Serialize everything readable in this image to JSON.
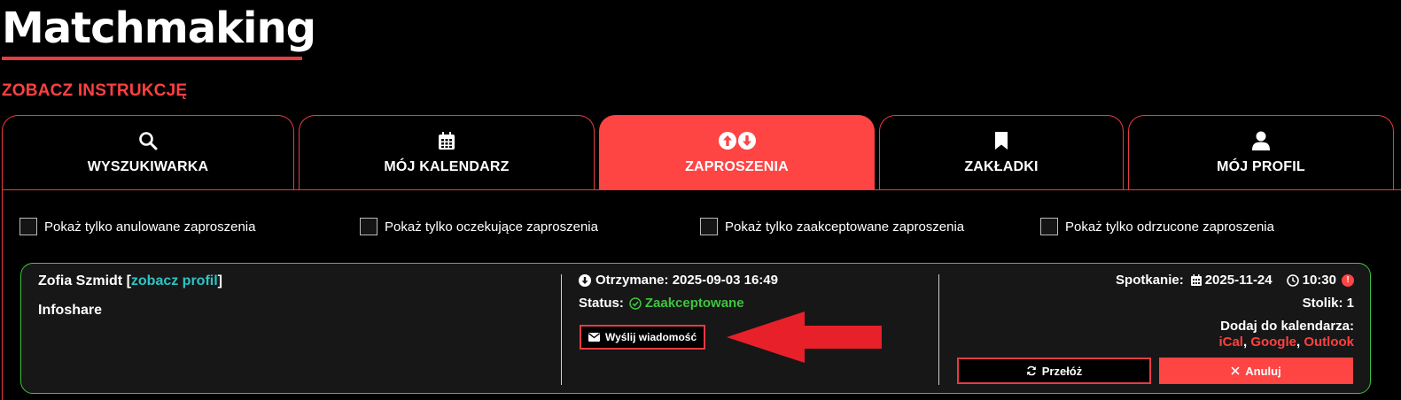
{
  "page": {
    "title": "Matchmaking",
    "instructions_link": "ZOBACZ INSTRUKCJĘ"
  },
  "tabs": [
    {
      "label": "WYSZUKIWARKA",
      "icon": "search-icon",
      "active": false
    },
    {
      "label": "MÓJ KALENDARZ",
      "icon": "calendar-icon",
      "active": false
    },
    {
      "label": "ZAPROSZENIA",
      "icon": "arrows-up-down-icon",
      "active": true
    },
    {
      "label": "ZAKŁADKI",
      "icon": "bookmark-icon",
      "active": false
    },
    {
      "label": "MÓJ PROFIL",
      "icon": "user-icon",
      "active": false
    }
  ],
  "filters": [
    {
      "label": "Pokaż tylko anulowane zaproszenia",
      "checked": false
    },
    {
      "label": "Pokaż tylko oczekujące zaproszenia",
      "checked": false
    },
    {
      "label": "Pokaż tylko zaakceptowane zaproszenia",
      "checked": false
    },
    {
      "label": "Pokaż tylko odrzucone zaproszenia",
      "checked": false
    }
  ],
  "invitation": {
    "name": "Zofia Szmidt",
    "profile_link": "zobacz profil",
    "event": "Infoshare",
    "received_label": "Otrzymane:",
    "received_value": "2025-09-03 16:49",
    "status_label": "Status:",
    "status_value": "Zaakceptowane",
    "message_button": "Wyślij wiadomość",
    "meeting_label": "Spotkanie:",
    "meeting_date": "2025-11-24",
    "meeting_time": "10:30",
    "alert_mark": "!",
    "table_label": "Stolik: 1",
    "add_to_calendar_label": "Dodaj do kalendarza:",
    "calendar_links": [
      "iCal",
      "Google",
      "Outlook"
    ],
    "reschedule_button": "Przełóż",
    "cancel_button": "Anuluj"
  },
  "colors": {
    "accent": "#ff4444",
    "border_accent": "#e63c42",
    "success": "#3ec43e",
    "link": "#2ec4c4",
    "card_bg": "#171717",
    "annotation_arrow": "#e8202a"
  }
}
